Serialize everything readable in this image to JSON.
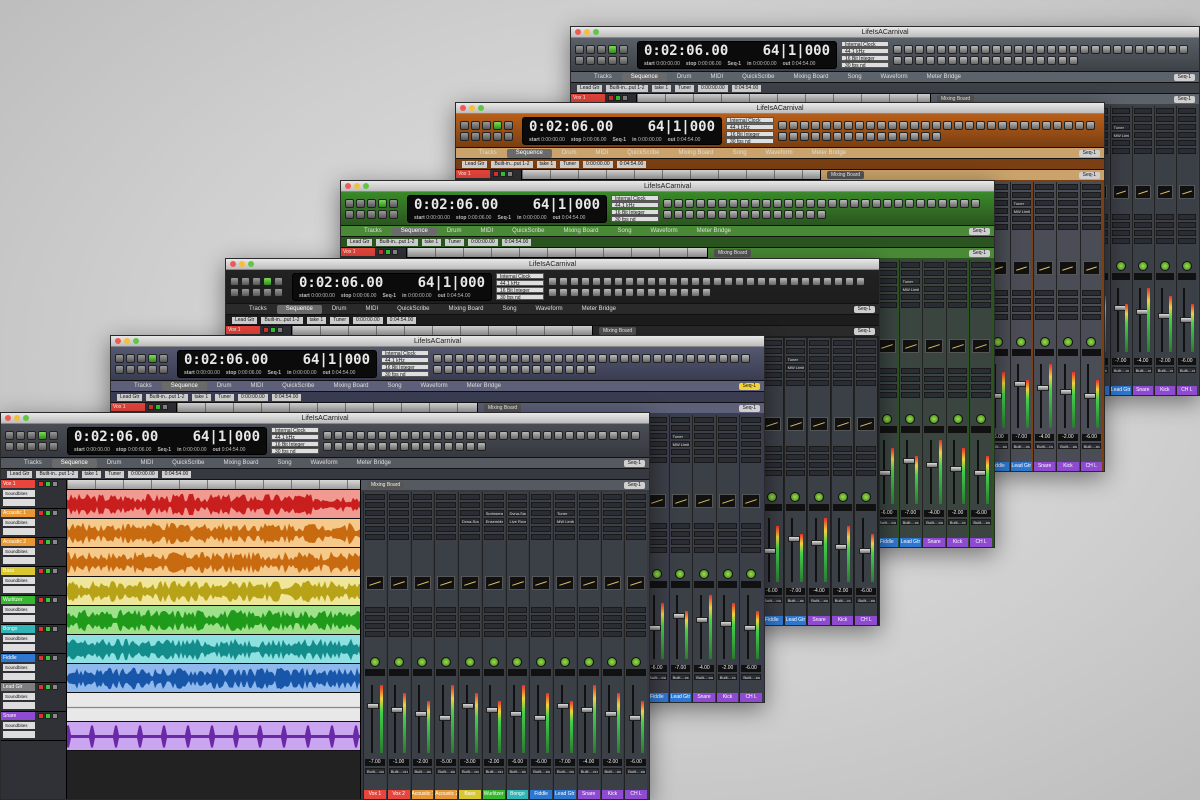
{
  "window_title": "LifeIsACarnival",
  "counter": {
    "time": "0:02:06.00",
    "bars": "64|1|000",
    "start_label": "start",
    "start_value": "0:00:00.00",
    "stop_label": "stop",
    "stop_value": "0:00:06.00",
    "in_label": "in",
    "in_value": "0:00:00.00",
    "out_label": "out",
    "out_value": "0:04:54.00",
    "seq_label": "Seq-1"
  },
  "clock": {
    "source": "Internal Clock",
    "rate": "44.1 kHz",
    "bits": "16 Bit Integer",
    "fps": "30 fps nd"
  },
  "tabs": [
    "Tracks",
    "Sequence",
    "Drum",
    "MIDI",
    "QuickScribe",
    "Mixing Board",
    "Song",
    "Waveform",
    "Meter Bridge"
  ],
  "active_tab": "Sequence",
  "seq_chip": "Seq-1",
  "mixer_title": "Mixing Board",
  "track_header": {
    "track": "Lead Gtr",
    "input": "Built-in...put 1-2",
    "take": "take 1",
    "tuner": "Tuner",
    "pos1": "0:00:00.00",
    "pos2": "0:04:54.00"
  },
  "tracks": [
    {
      "name": "Vox 1",
      "color": "#e8463c",
      "input": "Soundbites",
      "lane": "#f09a92",
      "wave": "#c81e1e"
    },
    {
      "name": "Acoustic 1",
      "color": "#e89832",
      "input": "Soundbites",
      "lane": "#f5c98a",
      "wave": "#c86a10"
    },
    {
      "name": "Acoustic 2",
      "color": "#e89832",
      "input": "Soundbites",
      "lane": "#f5c98a",
      "wave": "#c86a10"
    },
    {
      "name": "Bass",
      "color": "#d9c732",
      "input": "Soundbites",
      "lane": "#efe69a",
      "wave": "#b8a318"
    },
    {
      "name": "Wurlitzer",
      "color": "#36b82e",
      "input": "Soundbites",
      "lane": "#9fe08a",
      "wave": "#1f9a1a"
    },
    {
      "name": "Bongo",
      "color": "#2fb5b5",
      "input": "Soundbites",
      "lane": "#8fe0e0",
      "wave": "#138c8c"
    },
    {
      "name": "Fiddle",
      "color": "#2e77d0",
      "input": "Soundbites",
      "lane": "#8fb8ec",
      "wave": "#1756a8"
    },
    {
      "name": "Lead Gtr",
      "color": "#7e7e7e",
      "input": "Soundbites",
      "lane": "#e8e8e8",
      "wave": "#888888"
    },
    {
      "name": "Snare",
      "color": "#8e4ad0",
      "input": "Soundbites",
      "lane": "#c9a6ef",
      "wave": "#6a2aa8"
    }
  ],
  "mixer_strips": [
    {
      "name": "Vox 1",
      "color": "#e8463c",
      "insert1": "",
      "insert2": "",
      "vol": "-7.00",
      "out": "Built-...put 1"
    },
    {
      "name": "Vox 2",
      "color": "#e8463c",
      "insert1": "",
      "insert2": "",
      "vol": "-1.00",
      "out": "Built-...put 1"
    },
    {
      "name": "Acoustic 1",
      "color": "#e89832",
      "insert1": "",
      "insert2": "",
      "vol": "-2.00",
      "out": "Built-...put 1"
    },
    {
      "name": "Acoustic 2",
      "color": "#e89832",
      "insert1": "",
      "insert2": "",
      "vol": "-5.00",
      "out": "Built-...put 1"
    },
    {
      "name": "Bass",
      "color": "#d9c732",
      "insert1": "",
      "insert2": "Dyna-Squash",
      "vol": "-3.00",
      "out": "Built-...put 1"
    },
    {
      "name": "Wurlitzer",
      "color": "#36b82e",
      "insert1": "Springera...",
      "insert2": "Ensemble",
      "vol": "-2.00",
      "out": "Built-...put 1"
    },
    {
      "name": "Bongo",
      "color": "#2fb5b5",
      "insert1": "Dyna-Squash",
      "insert2": "Live Room D",
      "vol": "-6.00",
      "out": "Built-...put 1"
    },
    {
      "name": "Fiddle",
      "color": "#2e77d0",
      "insert1": "",
      "insert2": "",
      "vol": "-6.00",
      "out": "Built-...put 1"
    },
    {
      "name": "Lead Gtr",
      "color": "#2e77d0",
      "insert1": "Tuner",
      "insert2": "MW Limiter",
      "vol": "-7.00",
      "out": "Built-...put 1"
    },
    {
      "name": "Snare",
      "color": "#8e4ad0",
      "insert1": "",
      "insert2": "",
      "vol": "-4.00",
      "out": "Built-...put 1"
    },
    {
      "name": "Kick",
      "color": "#8e4ad0",
      "insert1": "",
      "insert2": "",
      "vol": "-2.00",
      "out": "Built-...put 1"
    },
    {
      "name": "CH L",
      "color": "#8e4ad0",
      "insert1": "",
      "insert2": "",
      "vol": "-6.00",
      "out": "Built-...put 1"
    }
  ],
  "themes": [
    {
      "accent": "#5a6068",
      "tabbar": "#5d636b",
      "toolbar": "#3d4148"
    },
    {
      "accent": "#b8601a",
      "tabbar": "#c9a36b",
      "toolbar": "#7a3f12"
    },
    {
      "accent": "#3a8a2a",
      "tabbar": "#4a8a36",
      "toolbar": "#2b5520"
    },
    {
      "accent": "#222222",
      "tabbar": "#2a2a2a",
      "toolbar": "#1d1d1d"
    },
    {
      "accent": "#545870",
      "tabbar": "#5d6078",
      "toolbar": "#3a3d52"
    },
    {
      "accent": "#4a4d55",
      "tabbar": "#555960",
      "toolbar": "#36393f"
    }
  ]
}
